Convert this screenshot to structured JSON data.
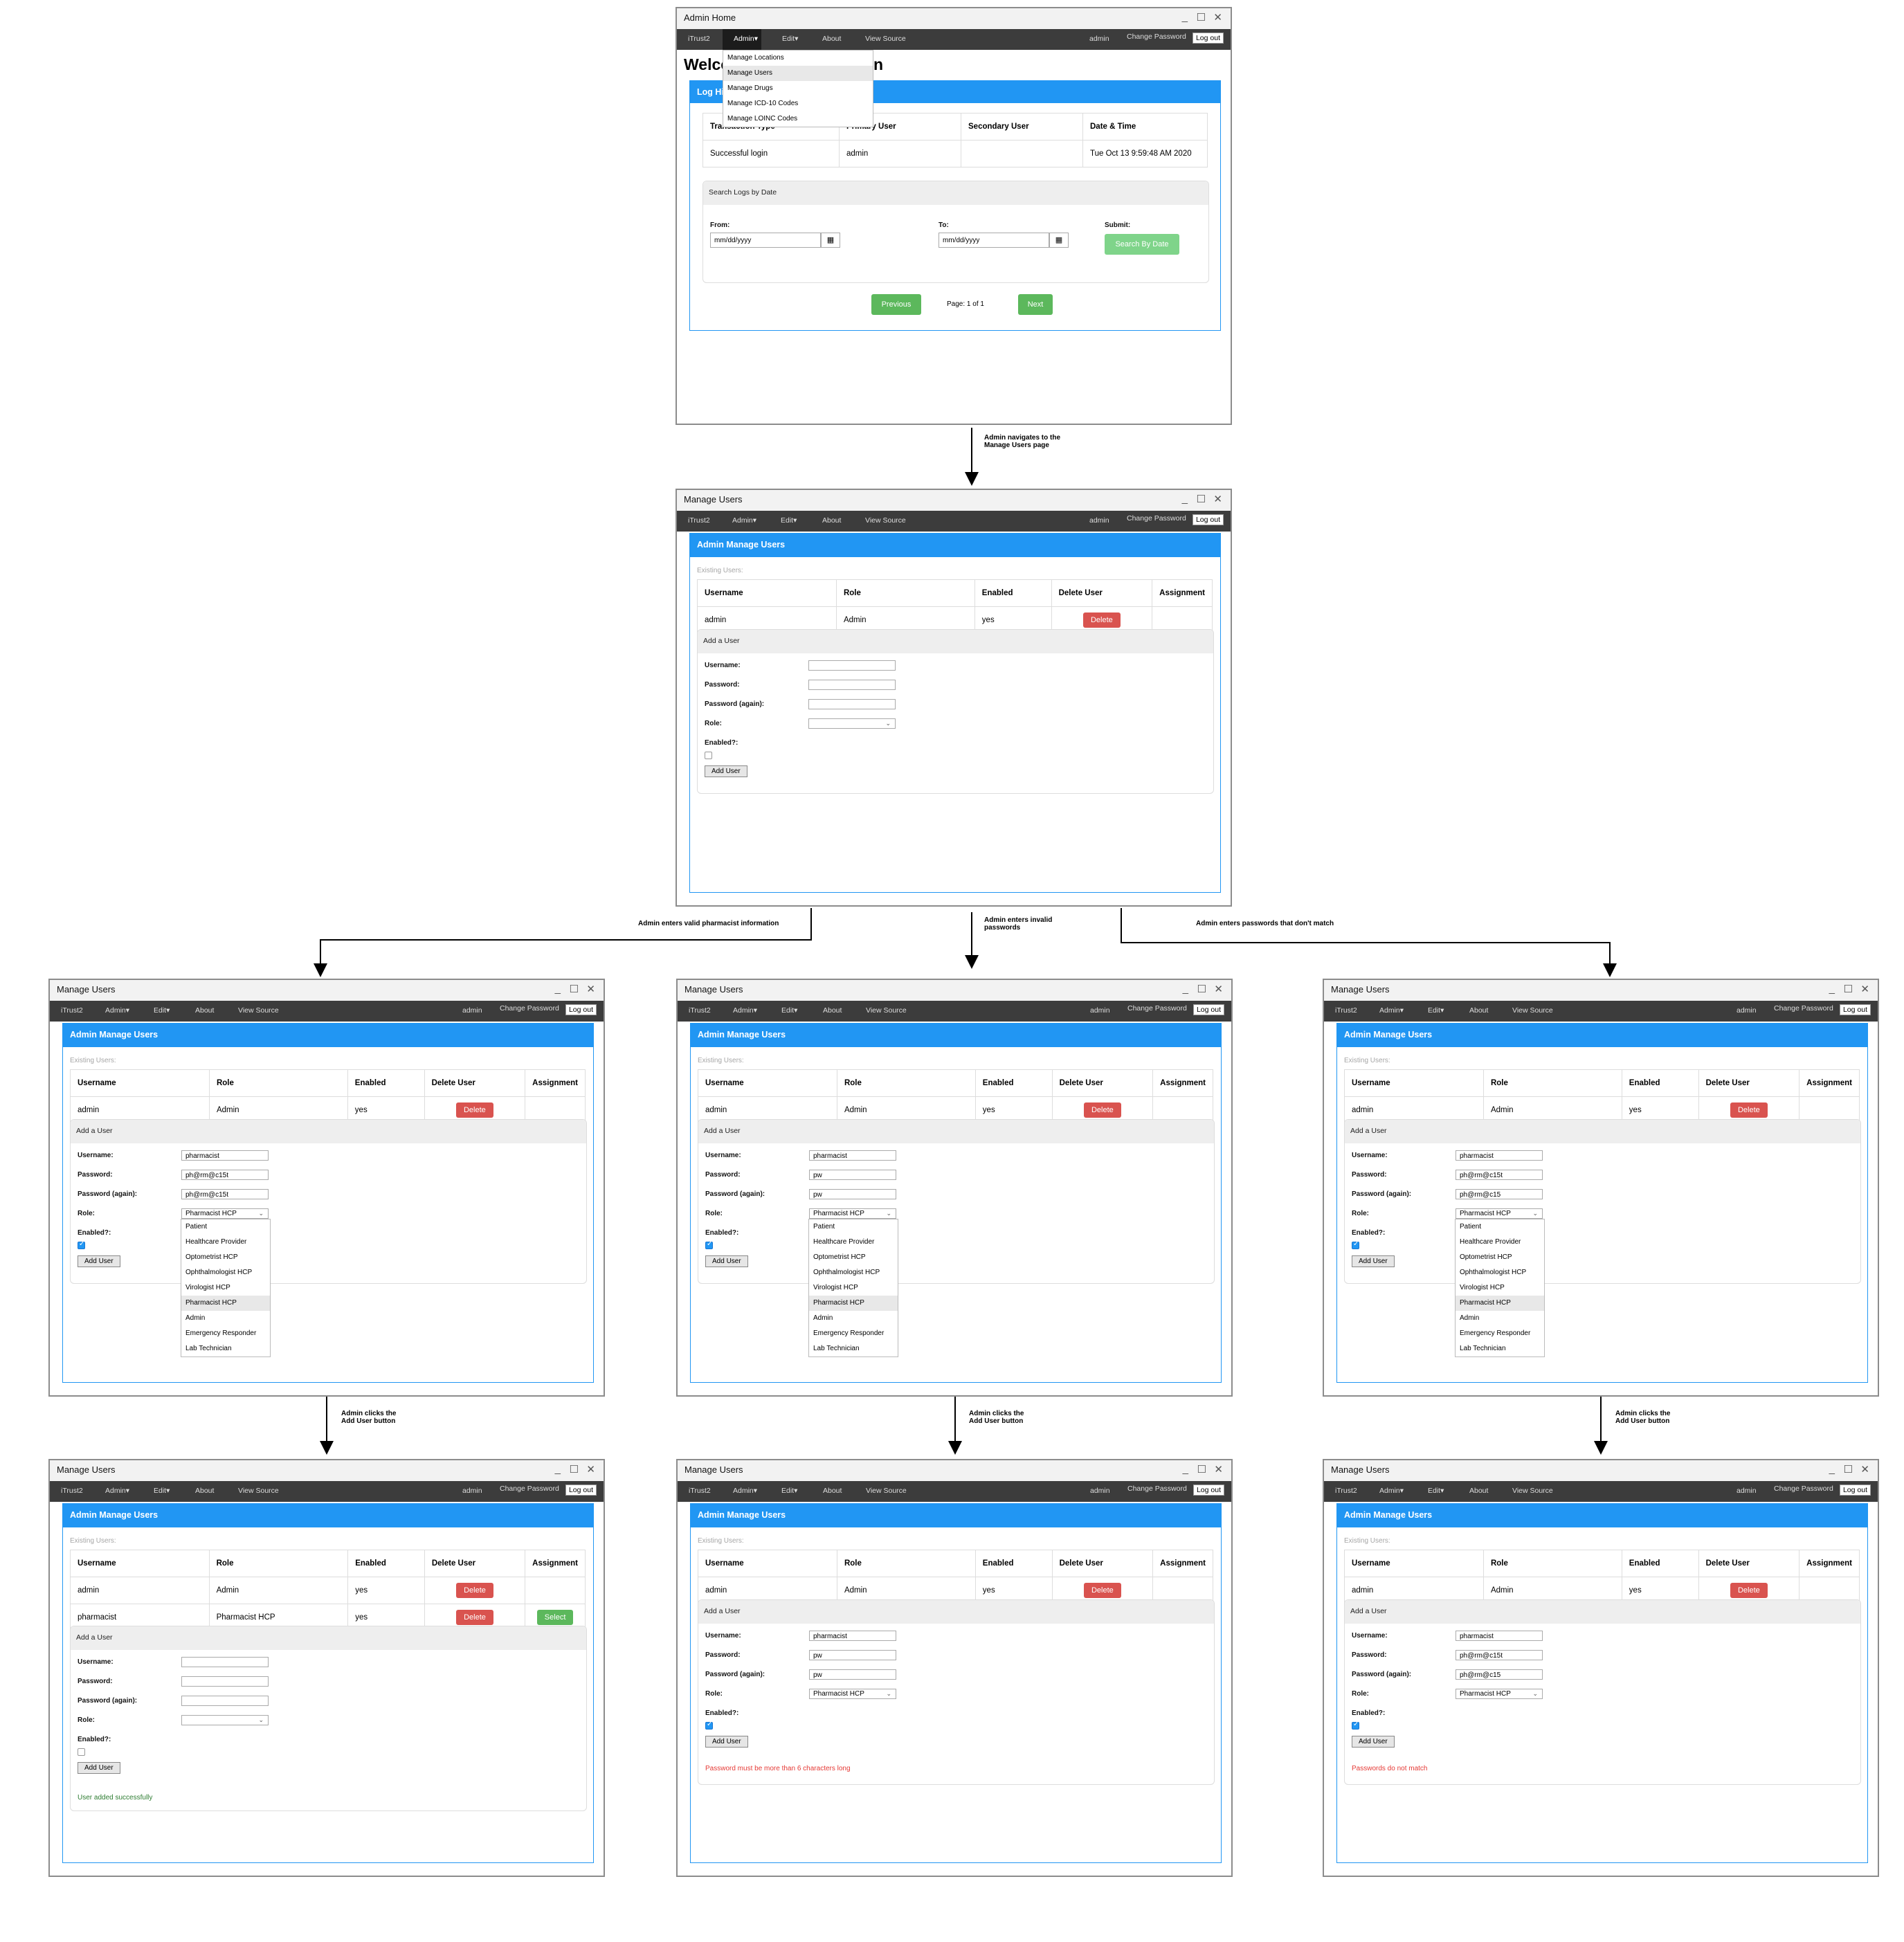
{
  "common": {
    "controls": {
      "minimize": "_",
      "maximize": "☐",
      "close": "✕"
    },
    "nav": {
      "brand": "iTrust2",
      "admin": "Admin▾",
      "edit": "Edit▾",
      "about": "About",
      "view_source": "View Source",
      "user": "admin",
      "change_password": "Change Password",
      "logout": "Log out"
    },
    "calendar_icon": "calendar-icon"
  },
  "home": {
    "window_title": "Admin Home",
    "heading_left": "Welco",
    "heading_right": "n",
    "panel_title_fragment": "Log Hi",
    "admin_menu": [
      "Manage Locations",
      "Manage Users",
      "Manage Drugs",
      "Manage ICD-10 Codes",
      "Manage LOINC Codes"
    ],
    "admin_menu_highlight": "Manage Users",
    "log_table": {
      "headers": [
        "Transaction Type",
        "Primary User",
        "Secondary User",
        "Date & Time"
      ],
      "rows": [
        [
          "Successful login",
          "admin",
          "",
          "Tue Oct 13 9:59:48 AM 2020"
        ]
      ]
    },
    "search": {
      "title": "Search Logs by Date",
      "from_label": "From:",
      "to_label": "To:",
      "submit_label": "Submit:",
      "from_placeholder": "mm/dd/yyyy",
      "to_placeholder": "mm/dd/yyyy",
      "button": "Search By Date"
    },
    "pager": {
      "previous": "Previous",
      "page_text": "Page: 1 of 1",
      "next": "Next"
    }
  },
  "manage": {
    "window_title": "Manage Users",
    "panel_title": "Admin Manage Users",
    "existing_label": "Existing Users:",
    "headers": [
      "Username",
      "Role",
      "Enabled",
      "Delete User",
      "Assignment"
    ],
    "admin_row": {
      "username": "admin",
      "role": "Admin",
      "enabled": "yes",
      "delete": "Delete"
    },
    "pharmacist_row": {
      "username": "pharmacist",
      "role": "Pharmacist HCP",
      "enabled": "yes",
      "delete": "Delete",
      "assign": "Select"
    },
    "form": {
      "title": "Add a User",
      "username_label": "Username:",
      "password_label": "Password:",
      "password_again_label": "Password (again):",
      "role_label": "Role:",
      "enabled_label": "Enabled?:",
      "add_button": "Add User"
    },
    "roles": [
      "Patient",
      "Healthcare Provider",
      "Optometrist HCP",
      "Ophthalmologist HCP",
      "Virologist HCP",
      "Pharmacist HCP",
      "Admin",
      "Emergency Responder",
      "Lab Technician"
    ],
    "role_highlight": "Pharmacist HCP"
  },
  "windows": {
    "w_valid": {
      "username": "pharmacist",
      "password": "ph@rm@c15t",
      "password_again": "ph@rm@c15t",
      "role": "Pharmacist HCP"
    },
    "w_short": {
      "username": "pharmacist",
      "password": "pw",
      "password_again": "pw",
      "role": "Pharmacist HCP"
    },
    "w_mismatch": {
      "username": "pharmacist",
      "password": "ph@rm@c15t",
      "password_again": "ph@rm@c15",
      "role": "Pharmacist HCP"
    },
    "w_success": {
      "username": "",
      "password": "",
      "password_again": "",
      "role": "",
      "message": "User added successfully"
    },
    "w_short_result": {
      "username": "pharmacist",
      "password": "pw",
      "password_again": "pw",
      "role": "Pharmacist HCP",
      "message": "Password must be more than 6 characters long"
    },
    "w_mismatch_result": {
      "username": "pharmacist",
      "password": "ph@rm@c15t",
      "password_again": "ph@rm@c15",
      "role": "Pharmacist HCP",
      "message": "Passwords do not match"
    }
  },
  "arrows": {
    "navigate": [
      "Admin navigates to the",
      "Manage Users page"
    ],
    "valid": "Admin enters valid pharmacist information",
    "invalid": [
      "Admin enters invalid",
      "passwords"
    ],
    "mismatch": "Admin enters passwords that don't match",
    "clicks_left": [
      "Admin clicks the",
      "Add User button"
    ],
    "clicks_mid": [
      "Admin clicks the",
      "Add User button"
    ],
    "clicks_right": [
      "Admin clicks the",
      "Add User button"
    ]
  }
}
